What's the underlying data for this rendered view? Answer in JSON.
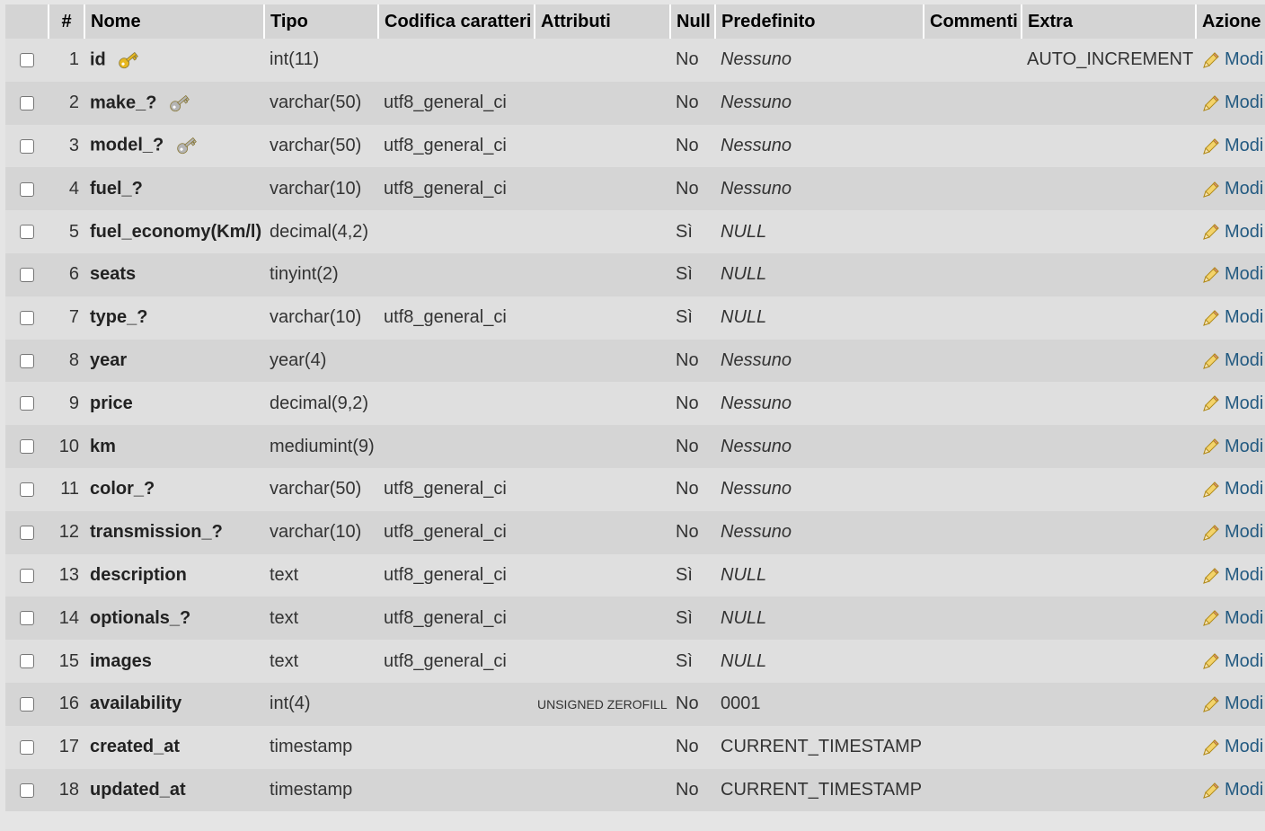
{
  "table": {
    "headers": {
      "num": "#",
      "name": "Nome",
      "type": "Tipo",
      "collation": "Codifica caratteri",
      "attributes": "Attributi",
      "null": "Null",
      "default": "Predefinito",
      "comments": "Commenti",
      "extra": "Extra",
      "action": "Azione"
    },
    "action_label": "Modi",
    "rows": [
      {
        "num": "1",
        "name": "id",
        "type": "int(11)",
        "collation": "",
        "attributes": "",
        "null": "No",
        "default": "Nessuno",
        "default_italic": true,
        "comments": "",
        "extra": "AUTO_INCREMENT",
        "key": "primary-key-icon"
      },
      {
        "num": "2",
        "name": "make_?",
        "type": "varchar(50)",
        "collation": "utf8_general_ci",
        "attributes": "",
        "null": "No",
        "default": "Nessuno",
        "default_italic": true,
        "comments": "",
        "extra": "",
        "key": "index-key-icon"
      },
      {
        "num": "3",
        "name": "model_?",
        "type": "varchar(50)",
        "collation": "utf8_general_ci",
        "attributes": "",
        "null": "No",
        "default": "Nessuno",
        "default_italic": true,
        "comments": "",
        "extra": "",
        "key": "index-key-icon"
      },
      {
        "num": "4",
        "name": "fuel_?",
        "type": "varchar(10)",
        "collation": "utf8_general_ci",
        "attributes": "",
        "null": "No",
        "default": "Nessuno",
        "default_italic": true,
        "comments": "",
        "extra": ""
      },
      {
        "num": "5",
        "name": "fuel_economy(Km/l)",
        "type": "decimal(4,2)",
        "collation": "",
        "attributes": "",
        "null": "Sì",
        "default": "NULL",
        "default_italic": true,
        "comments": "",
        "extra": ""
      },
      {
        "num": "6",
        "name": "seats",
        "type": "tinyint(2)",
        "collation": "",
        "attributes": "",
        "null": "Sì",
        "default": "NULL",
        "default_italic": true,
        "comments": "",
        "extra": ""
      },
      {
        "num": "7",
        "name": "type_?",
        "type": "varchar(10)",
        "collation": "utf8_general_ci",
        "attributes": "",
        "null": "Sì",
        "default": "NULL",
        "default_italic": true,
        "comments": "",
        "extra": ""
      },
      {
        "num": "8",
        "name": "year",
        "type": "year(4)",
        "collation": "",
        "attributes": "",
        "null": "No",
        "default": "Nessuno",
        "default_italic": true,
        "comments": "",
        "extra": ""
      },
      {
        "num": "9",
        "name": "price",
        "type": "decimal(9,2)",
        "collation": "",
        "attributes": "",
        "null": "No",
        "default": "Nessuno",
        "default_italic": true,
        "comments": "",
        "extra": ""
      },
      {
        "num": "10",
        "name": "km",
        "type": "mediumint(9)",
        "collation": "",
        "attributes": "",
        "null": "No",
        "default": "Nessuno",
        "default_italic": true,
        "comments": "",
        "extra": ""
      },
      {
        "num": "11",
        "name": "color_?",
        "type": "varchar(50)",
        "collation": "utf8_general_ci",
        "attributes": "",
        "null": "No",
        "default": "Nessuno",
        "default_italic": true,
        "comments": "",
        "extra": ""
      },
      {
        "num": "12",
        "name": "transmission_?",
        "type": "varchar(10)",
        "collation": "utf8_general_ci",
        "attributes": "",
        "null": "No",
        "default": "Nessuno",
        "default_italic": true,
        "comments": "",
        "extra": ""
      },
      {
        "num": "13",
        "name": "description",
        "type": "text",
        "collation": "utf8_general_ci",
        "attributes": "",
        "null": "Sì",
        "default": "NULL",
        "default_italic": true,
        "comments": "",
        "extra": ""
      },
      {
        "num": "14",
        "name": "optionals_?",
        "type": "text",
        "collation": "utf8_general_ci",
        "attributes": "",
        "null": "Sì",
        "default": "NULL",
        "default_italic": true,
        "comments": "",
        "extra": ""
      },
      {
        "num": "15",
        "name": "images",
        "type": "text",
        "collation": "utf8_general_ci",
        "attributes": "",
        "null": "Sì",
        "default": "NULL",
        "default_italic": true,
        "comments": "",
        "extra": ""
      },
      {
        "num": "16",
        "name": "availability",
        "type": "int(4)",
        "collation": "",
        "attributes": "UNSIGNED ZEROFILL",
        "null": "No",
        "default": "0001",
        "default_italic": false,
        "comments": "",
        "extra": ""
      },
      {
        "num": "17",
        "name": "created_at",
        "type": "timestamp",
        "collation": "",
        "attributes": "",
        "null": "No",
        "default": "CURRENT_TIMESTAMP",
        "default_italic": false,
        "comments": "",
        "extra": ""
      },
      {
        "num": "18",
        "name": "updated_at",
        "type": "timestamp",
        "collation": "",
        "attributes": "",
        "null": "No",
        "default": "CURRENT_TIMESTAMP",
        "default_italic": false,
        "comments": "",
        "extra": ""
      }
    ]
  },
  "colors": {
    "header_bg": "#d4d4d4",
    "row_odd": "#dfdfdf",
    "row_even": "#d5d5d5",
    "link": "#235a81",
    "primary_key": "#e8b820",
    "index_key": "#b5b5b5"
  }
}
